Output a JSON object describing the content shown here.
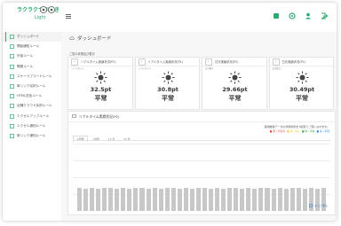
{
  "app": {
    "logo_text": "ラクラクつぶやき",
    "logo_sub": "Light"
  },
  "sidebar": {
    "items": [
      {
        "label": "ダッシュボード",
        "icon": "dashboard-icon"
      },
      {
        "label": "開始通知ルール",
        "icon": "bell-icon"
      },
      {
        "label": "外部ルール",
        "icon": "box-icon"
      },
      {
        "label": "関連ルール",
        "icon": "link-icon"
      },
      {
        "label": "スケーラブコードルール",
        "icon": "code-icon"
      },
      {
        "label": "単リンク採択ルール",
        "icon": "table-icon"
      },
      {
        "label": "HTML送信ルール",
        "icon": "html-icon"
      },
      {
        "label": "店舗クラウド採択ルール",
        "icon": "store-icon"
      },
      {
        "label": "エクセルアップルール",
        "icon": "excel-icon"
      },
      {
        "label": "エクセル通知ルール",
        "icon": "mail-icon"
      },
      {
        "label": "単リンク通知ルール",
        "icon": "share-icon"
      }
    ]
  },
  "main": {
    "title": "ダッシュボード",
    "section_label": "ご覧の状態及び表示",
    "cards": [
      {
        "title": "リアルタイム実績状況(P2)",
        "badge": "P",
        "subtitle": "リアルタイム",
        "value": "32.5pt",
        "status": "平常"
      },
      {
        "title": "リアルタイム実績状況(P1)",
        "badge": "P",
        "subtitle": "リアルタイム",
        "value": "30.8pt",
        "status": "平常"
      },
      {
        "title": "日次実績状況(P2)",
        "badge": "P",
        "subtitle": "日次集計",
        "value": "29.66pt",
        "status": "平常"
      },
      {
        "title": "日次実績状況(P1)",
        "badge": "P",
        "subtitle": "日次集計",
        "value": "30.49pt",
        "status": "平常"
      }
    ],
    "panel": {
      "title": "リアルタイム実績状況(P2)",
      "note": "週間推移データの状態判別を7段階でご覧になれます。",
      "legend": [
        {
          "label": "■ 赤 / 大荒れ",
          "color": "#e53935"
        },
        {
          "label": "■ 黄 / 荒れ",
          "color": "#fbc02d"
        },
        {
          "label": "■ 緑 / 平常",
          "color": "#43a047"
        },
        {
          "label": "■ 青 / 平穏",
          "color": "#1e88e5"
        }
      ],
      "tabs": [
        "1日間",
        "1週間",
        "1ヶ月",
        "3ヶ月"
      ],
      "active_tab": 0,
      "footer_link": "もっと見る"
    }
  },
  "chart_data": {
    "type": "bar",
    "categories": [
      "1",
      "2",
      "3",
      "4",
      "5",
      "6",
      "7",
      "8",
      "9",
      "10",
      "11",
      "12",
      "13",
      "14",
      "15",
      "16",
      "17",
      "18",
      "19",
      "20",
      "21",
      "22",
      "23",
      "24",
      "25",
      "26",
      "27",
      "28",
      "29",
      "30",
      "31",
      "32",
      "33",
      "34",
      "35",
      "36",
      "37",
      "38",
      "39",
      "40"
    ],
    "values": [
      34,
      33,
      34,
      33,
      34,
      34,
      33,
      34,
      33,
      34,
      34,
      33,
      34,
      33,
      34,
      34,
      33,
      34,
      33,
      34,
      34,
      33,
      34,
      33,
      34,
      34,
      33,
      34,
      33,
      34,
      34,
      33,
      34,
      33,
      34,
      34,
      33,
      34,
      33,
      34
    ],
    "ylim": [
      0,
      100
    ],
    "color": "#c8c8c8"
  },
  "colors": {
    "accent": "#2aa86f",
    "link": "#2a6fb8"
  }
}
